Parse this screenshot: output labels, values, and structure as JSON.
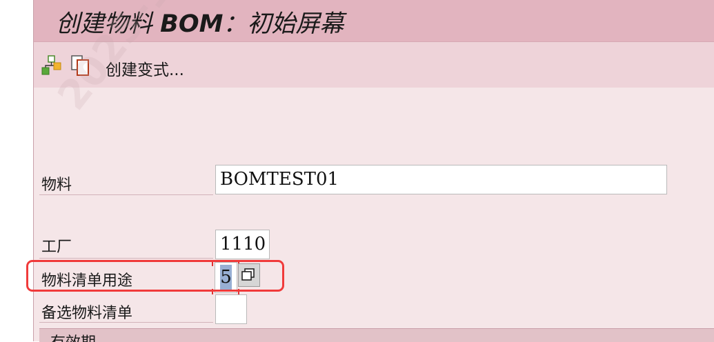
{
  "screen": {
    "title_prefix": "创建物料 ",
    "title_bold": "BOM",
    "title_suffix": "：初始屏幕"
  },
  "toolbar": {
    "hierarchy_icon": "hierarchy-icon",
    "copy_icon": "copy-icon",
    "create_variant_label": "创建变式..."
  },
  "watermark": "2025-11-20",
  "form": {
    "material_label": "物料",
    "material_value": "BOMTEST01",
    "plant_label": "工厂",
    "plant_value": "1110",
    "usage_label": "物料清单用途",
    "usage_value": "5",
    "alt_bom_label": "备选物料清单",
    "alt_bom_value": ""
  },
  "group": {
    "validity_title": "有效期"
  },
  "colors": {
    "title_bg": "#e2b4bf",
    "toolbar_bg": "#eed3d9",
    "main_bg": "#f5e6e8",
    "highlight": "#f03a3a",
    "selection": "#98afd4"
  }
}
